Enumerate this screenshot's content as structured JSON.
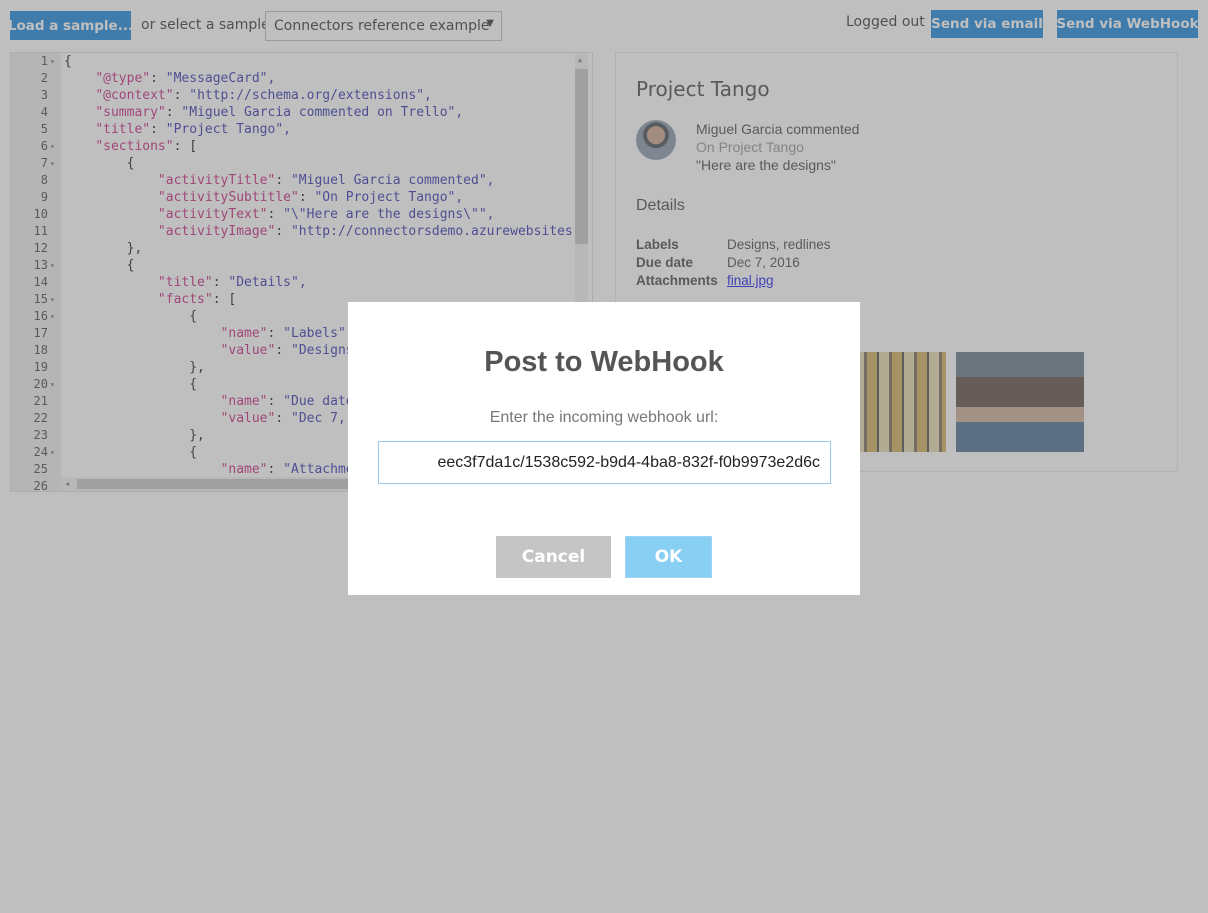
{
  "toolbar": {
    "load_label": "Load a sample...",
    "or_select": "or select a sample:",
    "selected_sample": "Connectors reference example",
    "login_status": "Logged out",
    "email_label": "Send via email",
    "webhook_label": "Send via WebHook"
  },
  "editor": {
    "lines": [
      {
        "n": "1",
        "fold": true,
        "text": "{"
      },
      {
        "n": "2",
        "fold": false,
        "text": "    \"@type\": \"MessageCard\","
      },
      {
        "n": "3",
        "fold": false,
        "text": "    \"@context\": \"http://schema.org/extensions\","
      },
      {
        "n": "4",
        "fold": false,
        "text": "    \"summary\": \"Miguel Garcia commented on Trello\","
      },
      {
        "n": "5",
        "fold": false,
        "text": "    \"title\": \"Project Tango\","
      },
      {
        "n": "6",
        "fold": true,
        "text": "    \"sections\": ["
      },
      {
        "n": "7",
        "fold": true,
        "text": "        {"
      },
      {
        "n": "8",
        "fold": false,
        "text": "            \"activityTitle\": \"Miguel Garcia commented\","
      },
      {
        "n": "9",
        "fold": false,
        "text": "            \"activitySubtitle\": \"On Project Tango\","
      },
      {
        "n": "10",
        "fold": false,
        "text": "            \"activityText\": \"\\\"Here are the designs\\\"\","
      },
      {
        "n": "11",
        "fold": false,
        "text": "            \"activityImage\": \"http://connectorsdemo.azurewebsites.n"
      },
      {
        "n": "12",
        "fold": false,
        "text": "        },"
      },
      {
        "n": "13",
        "fold": true,
        "text": "        {"
      },
      {
        "n": "14",
        "fold": false,
        "text": "            \"title\": \"Details\","
      },
      {
        "n": "15",
        "fold": true,
        "text": "            \"facts\": ["
      },
      {
        "n": "16",
        "fold": true,
        "text": "                {"
      },
      {
        "n": "17",
        "fold": false,
        "text": "                    \"name\": \"Labels\","
      },
      {
        "n": "18",
        "fold": false,
        "text": "                    \"value\": \"Designs"
      },
      {
        "n": "19",
        "fold": false,
        "text": "                },"
      },
      {
        "n": "20",
        "fold": true,
        "text": "                {"
      },
      {
        "n": "21",
        "fold": false,
        "text": "                    \"name\": \"Due date"
      },
      {
        "n": "22",
        "fold": false,
        "text": "                    \"value\": \"Dec 7,"
      },
      {
        "n": "23",
        "fold": false,
        "text": "                },"
      },
      {
        "n": "24",
        "fold": true,
        "text": "                {"
      },
      {
        "n": "25",
        "fold": false,
        "text": "                    \"name\": \"Attachme"
      },
      {
        "n": "26",
        "fold": false,
        "text": ""
      }
    ]
  },
  "card": {
    "title": "Project Tango",
    "activity_title": "Miguel Garcia commented",
    "activity_subtitle": "On Project Tango",
    "activity_text": "\"Here are the designs\"",
    "section_title": "Details",
    "facts": [
      {
        "name": "Labels",
        "value": "Designs, redlines"
      },
      {
        "name": "Due date",
        "value": "Dec 7, 2016"
      },
      {
        "name": "Attachments",
        "value": "final.jpg"
      }
    ]
  },
  "modal": {
    "title": "Post to WebHook",
    "label": "Enter the incoming webhook url:",
    "url_value": "eec3f7da1c/1538c592-b9d4-4ba8-832f-f0b9973e2d6c",
    "cancel_label": "Cancel",
    "ok_label": "OK"
  },
  "colors": {
    "accent": "#0078d7",
    "ok_button": "#88cff3",
    "cancel_button": "#c5c5c5",
    "overlay": "#808080"
  }
}
